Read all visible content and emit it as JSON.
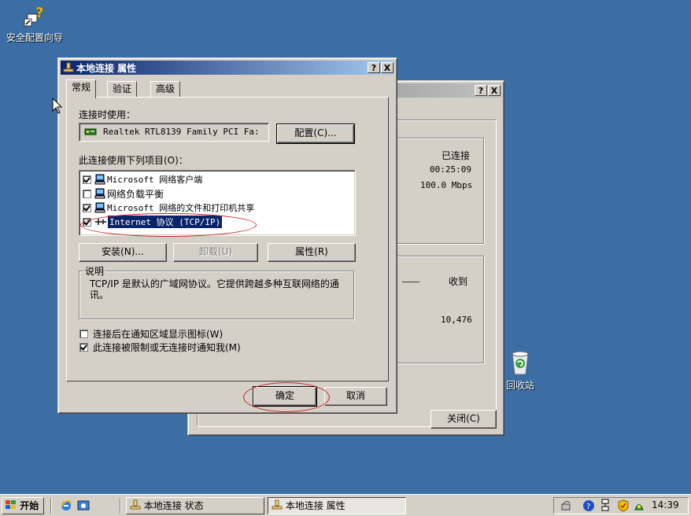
{
  "desktop": {
    "wizard_icon_label": "安全配置向导",
    "recycle_bin_label": "回收站"
  },
  "status_window": {
    "help_btn": "?",
    "close_btn": "X",
    "status_value": "已连接",
    "duration_value": "00:25:09",
    "speed_value": "100.0 Mbps",
    "received_label": "收到",
    "received_value": "10,476",
    "close_button": "关闭(C)"
  },
  "props_window": {
    "title": "本地连接 属性",
    "help_btn": "?",
    "close_btn": "X",
    "tabs": [
      "常规",
      "验证",
      "高级"
    ],
    "connect_using_label": "连接时使用：",
    "adapter_name": "Realtek RTL8139 Family PCI Fa:",
    "configure_button": "配置(C)...",
    "items_label": "此连接使用下列项目(O)：",
    "items": [
      {
        "label": "Microsoft 网络客户端",
        "checked": true
      },
      {
        "label": "网络负载平衡",
        "checked": false
      },
      {
        "label": "Microsoft 网络的文件和打印机共享",
        "checked": true
      },
      {
        "label": "Internet 协议 (TCP/IP)",
        "checked": true
      }
    ],
    "install_button": "安装(N)...",
    "uninstall_button": "卸载(U)",
    "properties_button": "属性(R)",
    "description_legend": "说明",
    "description_text": "TCP/IP 是默认的广域网协议。它提供跨越多种互联网络的通讯。",
    "show_icon_label": "连接后在通知区域显示图标(W)",
    "show_icon_checked": false,
    "notify_label": "此连接被限制或无连接时通知我(M)",
    "notify_checked": true,
    "ok_button": "确定",
    "cancel_button": "取消"
  },
  "taskbar": {
    "start_label": "开始",
    "tasks": [
      "本地连接 状态",
      "本地连接 属性"
    ],
    "clock": "14:39"
  }
}
